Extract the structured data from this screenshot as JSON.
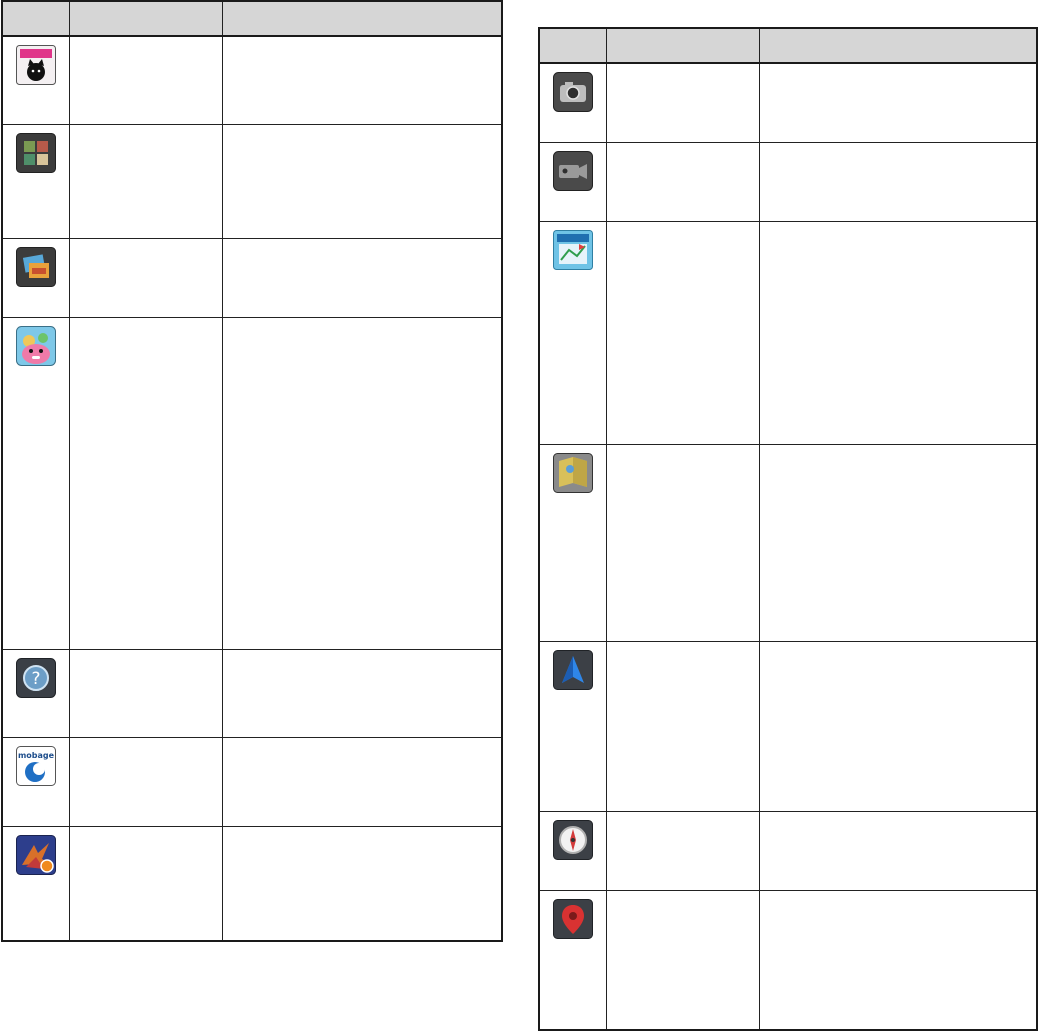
{
  "left_table": {
    "rows": [
      {
        "icon": "orista-cat-app-icon"
      },
      {
        "icon": "photo-collage-app-icon"
      },
      {
        "icon": "gallery-app-icon"
      },
      {
        "icon": "pink-monster-app-icon"
      },
      {
        "icon": "help-question-app-icon"
      },
      {
        "icon": "mobage-app-icon",
        "icon_text": "mobage"
      },
      {
        "icon": "dragon-game-app-icon"
      }
    ]
  },
  "right_table": {
    "rows": [
      {
        "icon": "camera-app-icon"
      },
      {
        "icon": "video-camera-app-icon"
      },
      {
        "icon": "map-app-icon"
      },
      {
        "icon": "photo-map-app-icon"
      },
      {
        "icon": "navigation-arrow-app-icon"
      },
      {
        "icon": "compass-app-icon"
      },
      {
        "icon": "map-pin-app-icon"
      }
    ]
  }
}
